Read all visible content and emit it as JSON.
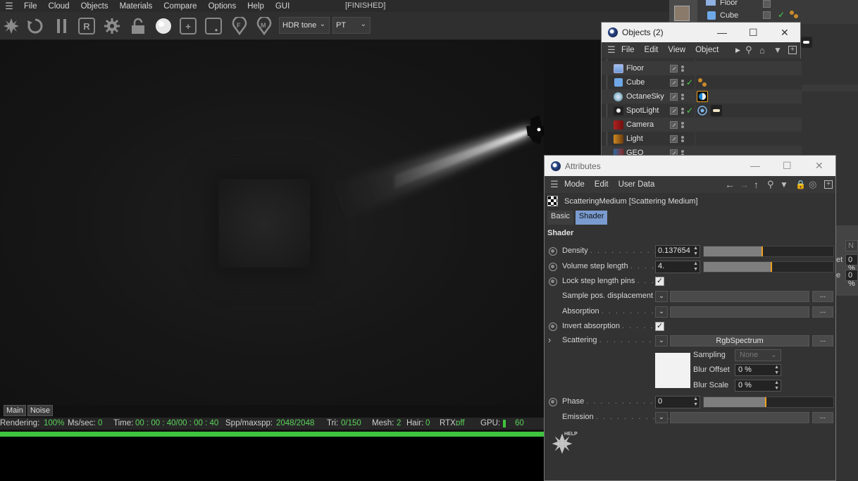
{
  "octane": {
    "menu": [
      "File",
      "Cloud",
      "Objects",
      "Materials",
      "Compare",
      "Options",
      "Help",
      "GUI"
    ],
    "status": "[FINISHED]",
    "toolbar": {
      "tone_mode": "HDR tone",
      "kernel": "PT"
    },
    "viewport_tabs": [
      "Main",
      "Noise"
    ],
    "stats": {
      "rendering_label": "Rendering:",
      "rendering_value": "100%",
      "mssec_label": "Ms/sec:",
      "mssec_value": "0",
      "time_label": "Time:",
      "time_value": "00 : 00 : 40/00 : 00 : 40",
      "spp_label": "Spp/maxspp:",
      "spp_value": "2048/2048",
      "tri_label": "Tri:",
      "tri_value": "0/150",
      "mesh_label": "Mesh:",
      "mesh_value": "2",
      "hair_label": "Hair:",
      "hair_value": "0",
      "rtx_label": "RTX:",
      "rtx_value": "off",
      "gpu_label": "GPU:",
      "gpu_value": "60"
    },
    "progress": 1.0,
    "accent_green": "#3ec43e"
  },
  "background_objects": {
    "rows": [
      "Floor",
      "Cube"
    ]
  },
  "objects_window": {
    "title": "Objects (2)",
    "menu": [
      "File",
      "Edit",
      "View",
      "Object"
    ],
    "items": [
      {
        "name": "Floor",
        "icon": "floor-icon"
      },
      {
        "name": "Cube",
        "icon": "cube-icon"
      },
      {
        "name": "OctaneSky",
        "icon": "sky-icon"
      },
      {
        "name": "SpotLight",
        "icon": "spotlight-icon"
      },
      {
        "name": "Camera",
        "icon": "camera-icon"
      },
      {
        "name": "Light",
        "icon": "light-icon"
      },
      {
        "name": "GEO",
        "icon": "geo-icon"
      }
    ]
  },
  "attributes_window": {
    "title": "Attributes",
    "menu": [
      "Mode",
      "Edit",
      "User Data"
    ],
    "object_label": "ScatteringMedium [Scattering Medium]",
    "tabs": [
      "Basic",
      "Shader"
    ],
    "active_tab": "Shader",
    "section": "Shader",
    "params": {
      "density": {
        "label": "Density",
        "value": "0.137654",
        "fill": 0.45,
        "pin": 0.45
      },
      "volume_step": {
        "label": "Volume step length",
        "value": "4.",
        "fill": 0.52,
        "pin": 0.52
      },
      "lock_pins": {
        "label": "Lock step length pins",
        "checked": true
      },
      "sample_disp": {
        "label": "Sample pos. displacement"
      },
      "absorption": {
        "label": "Absorption"
      },
      "invert_abs": {
        "label": "Invert absorption",
        "checked": true
      },
      "scattering": {
        "label": "Scattering",
        "link": "RgbSpectrum"
      },
      "sampling": {
        "label": "Sampling",
        "value": "None"
      },
      "blur_offset": {
        "label": "Blur Offset",
        "value": "0 %"
      },
      "blur_scale": {
        "label": "Blur Scale",
        "value": "0 %"
      },
      "phase": {
        "label": "Phase",
        "value": "0",
        "fill": 0.48,
        "pin": 0.48
      },
      "emission": {
        "label": "Emission"
      }
    },
    "dots_button": "...",
    "help_label": "HELP"
  },
  "edge_panel": {
    "f1": "N",
    "f2": "0 %",
    "f3": "0 %",
    "l1": "et",
    "l2": "e"
  }
}
